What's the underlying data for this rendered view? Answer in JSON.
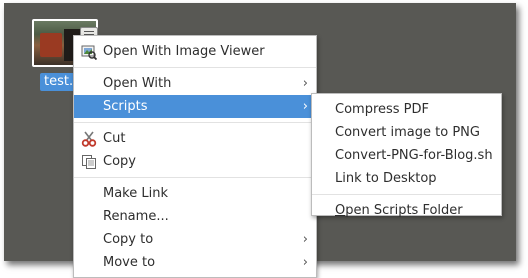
{
  "desktop": {
    "file_label": "test.p"
  },
  "context_menu": {
    "open_with_image_viewer": "Open With Image Viewer",
    "open_with": "Open With",
    "scripts": "Scripts",
    "cut": "Cut",
    "copy": "Copy",
    "make_link": "Make Link",
    "rename": "Rename...",
    "copy_to": "Copy to",
    "move_to": "Move to"
  },
  "scripts_menu": {
    "items": [
      "Compress PDF",
      "Convert image to PNG",
      "Convert-PNG-for-Blog.sh",
      "Link to Desktop"
    ],
    "open_folder_first": "O",
    "open_folder_rest": "pen Scripts Folder"
  },
  "icons": {
    "submenu_arrow": "›",
    "image_viewer": "image-viewer-icon",
    "cut": "scissors-icon",
    "copy": "copy-icon"
  },
  "colors": {
    "highlight": "#4a90d9",
    "desktop_background": "#585854"
  }
}
